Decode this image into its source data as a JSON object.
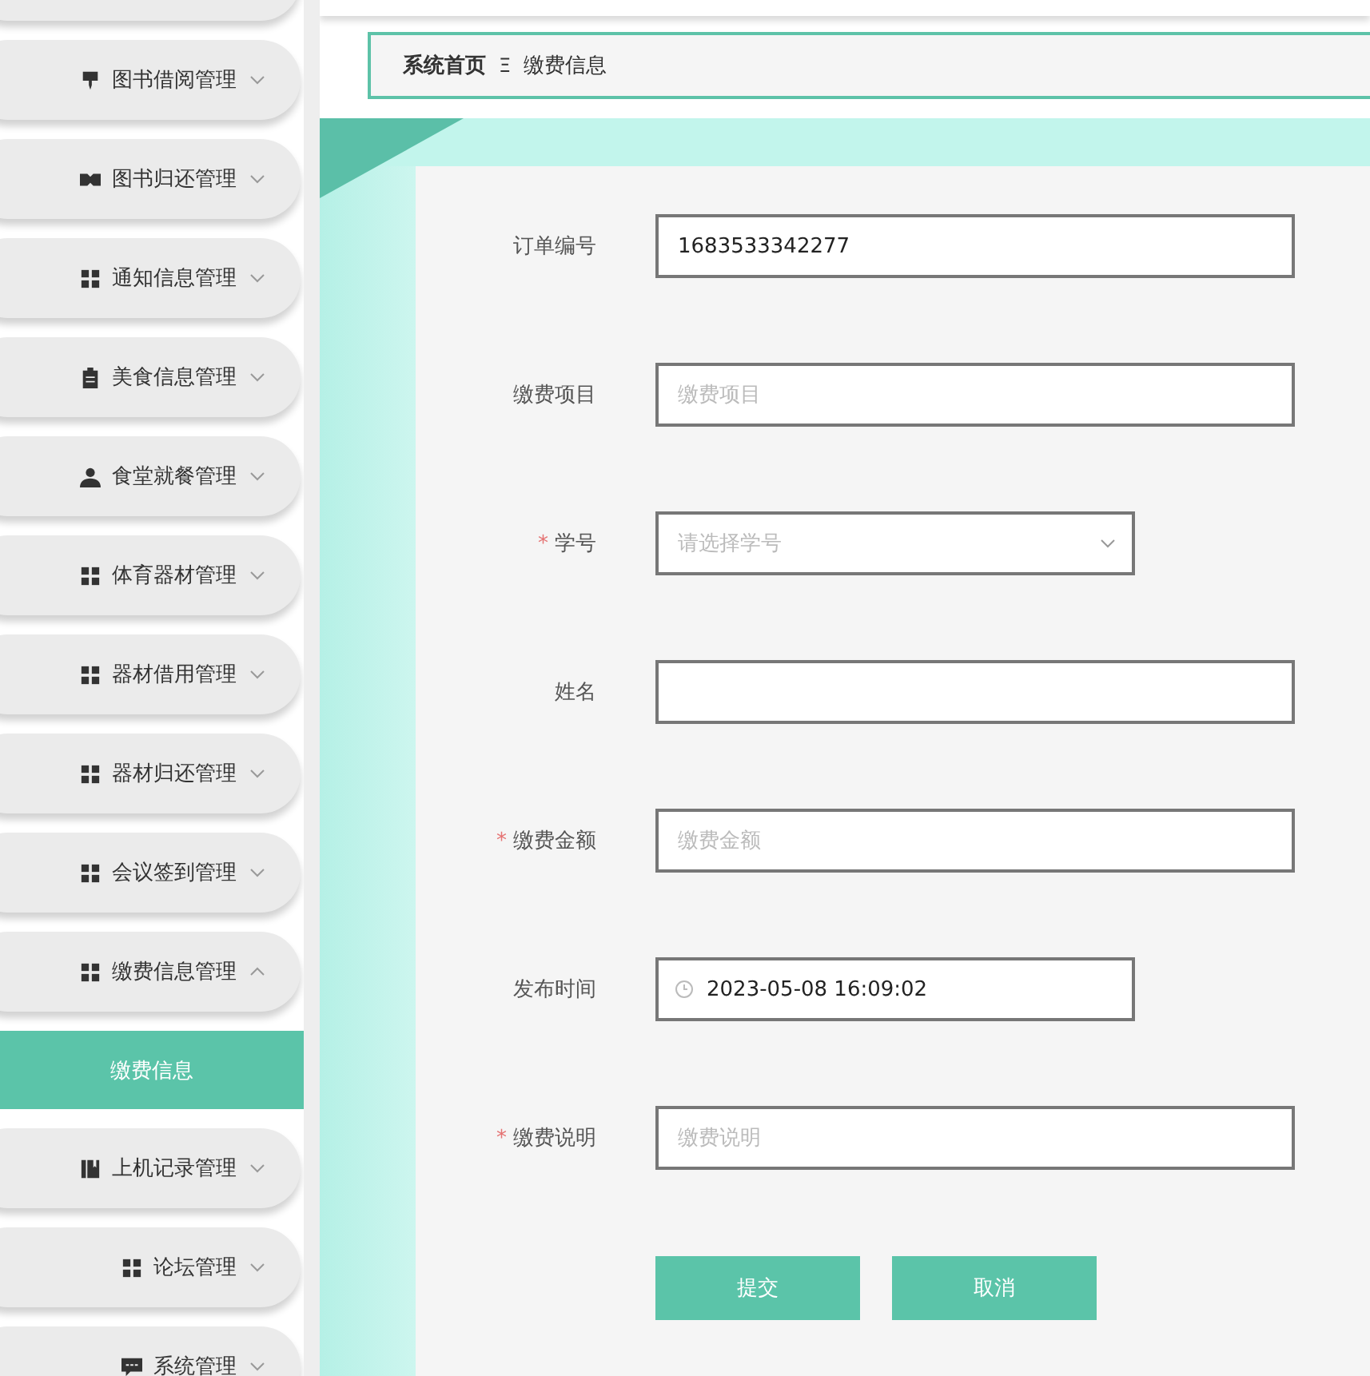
{
  "sidebar": {
    "items": [
      {
        "label": "图书借阅管理",
        "expanded": false
      },
      {
        "label": "图书归还管理",
        "expanded": false
      },
      {
        "label": "通知信息管理",
        "expanded": false
      },
      {
        "label": "美食信息管理",
        "expanded": false
      },
      {
        "label": "食堂就餐管理",
        "expanded": false
      },
      {
        "label": "体育器材管理",
        "expanded": false
      },
      {
        "label": "器材借用管理",
        "expanded": false
      },
      {
        "label": "器材归还管理",
        "expanded": false
      },
      {
        "label": "会议签到管理",
        "expanded": false
      },
      {
        "label": "缴费信息管理",
        "expanded": true,
        "children": [
          {
            "label": "缴费信息",
            "selected": true
          }
        ]
      },
      {
        "label": "上机记录管理",
        "expanded": false
      },
      {
        "label": "论坛管理",
        "expanded": false
      },
      {
        "label": "系统管理",
        "expanded": false
      }
    ]
  },
  "breadcrumb": {
    "items": [
      "系统首页",
      "缴费信息"
    ],
    "separator": "Ξ"
  },
  "form": {
    "fields": [
      {
        "kind": "text",
        "label": "订单编号",
        "value": "1683533342277"
      },
      {
        "kind": "text",
        "label": "缴费项目",
        "placeholder": "缴费项目"
      },
      {
        "kind": "select",
        "label": "学号",
        "required_mark": "*",
        "placeholder": "请选择学号"
      },
      {
        "kind": "text",
        "label": "姓名"
      },
      {
        "kind": "text",
        "label": "缴费金额",
        "required_mark": "*",
        "placeholder": "缴费金额"
      },
      {
        "kind": "date",
        "label": "发布时间",
        "value": "2023-05-08 16:09:02"
      },
      {
        "kind": "text",
        "label": "缴费说明",
        "required_mark": "*",
        "placeholder": "缴费说明"
      }
    ],
    "buttons": [
      "提交",
      "取消"
    ]
  }
}
